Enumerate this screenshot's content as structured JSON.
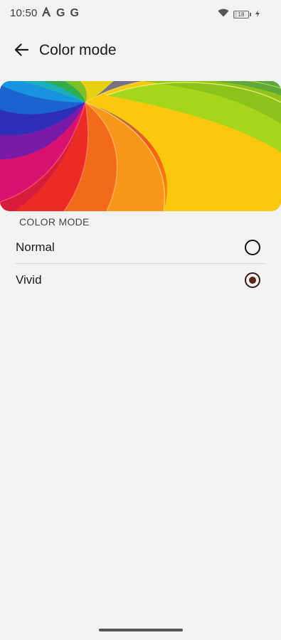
{
  "status_bar": {
    "time": "10:50",
    "left_icons": [
      "autofill-icon",
      "google-icon",
      "google-icon"
    ],
    "google_glyph": "G",
    "battery_level": "18",
    "battery_fraction": 0.18,
    "right_icons": [
      "wifi-icon",
      "battery-icon",
      "charging-icon"
    ]
  },
  "app_bar": {
    "back_icon": "back-arrow-icon",
    "title": "Color mode"
  },
  "banner": {
    "description_icon": "color-swirl-wallpaper"
  },
  "color_mode": {
    "section_header": "COLOR MODE",
    "options": [
      {
        "label": "Normal",
        "selected": false
      },
      {
        "label": "Vivid",
        "selected": true
      }
    ]
  },
  "colors": {
    "background": "#f2f2f2",
    "radio_selected": "#5a2418",
    "text_primary": "#1a1a1a"
  }
}
